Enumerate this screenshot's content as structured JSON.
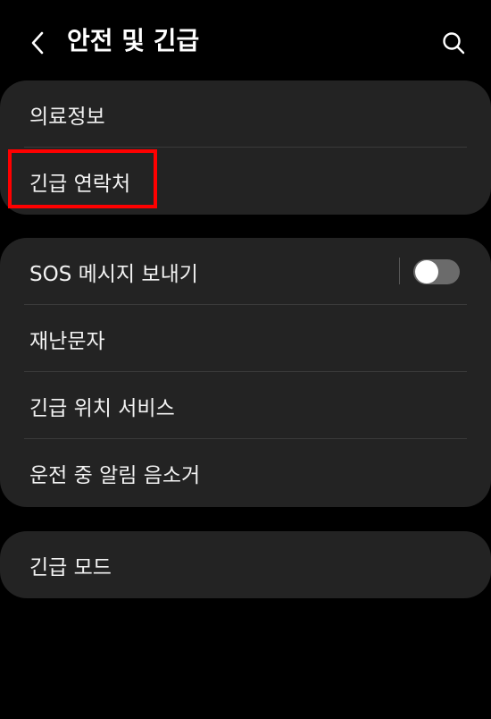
{
  "header": {
    "title": "안전 및 긴급",
    "back_icon": "chevron-left-icon",
    "search_icon": "search-icon"
  },
  "group1": {
    "items": [
      {
        "label": "의료정보"
      },
      {
        "label": "긴급 연락처"
      }
    ]
  },
  "group2": {
    "items": [
      {
        "label": "SOS 메시지 보내기",
        "toggle": false
      },
      {
        "label": "재난문자"
      },
      {
        "label": "긴급 위치 서비스"
      },
      {
        "label": "운전 중 알림 음소거"
      }
    ]
  },
  "group3": {
    "items": [
      {
        "label": "긴급 모드"
      }
    ]
  },
  "colors": {
    "background": "#000000",
    "card": "#232323",
    "highlight": "#ff0000",
    "toggle_off": "#6b6b6b"
  }
}
